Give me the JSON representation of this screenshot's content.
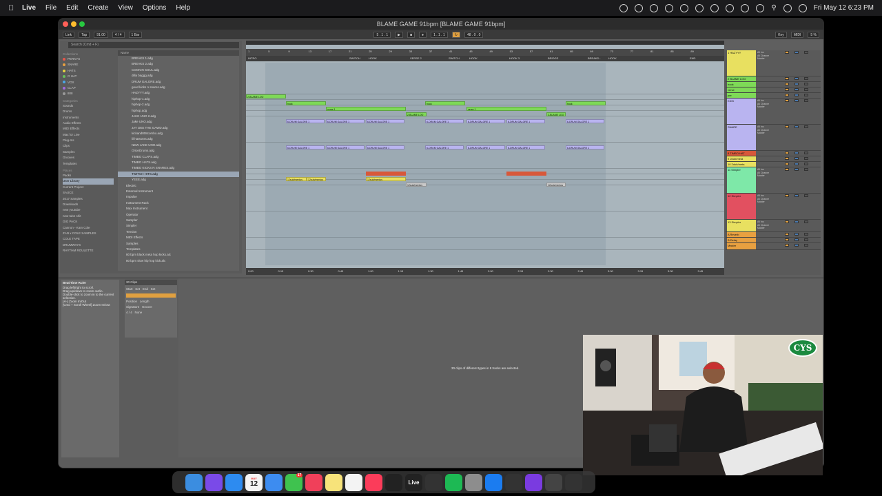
{
  "menubar": {
    "app_name": "Live",
    "items": [
      "File",
      "Edit",
      "Create",
      "View",
      "Options",
      "Help"
    ],
    "clock": "Fri May 12  6:23 PM"
  },
  "window": {
    "title": "BLAME GAME 91bpm  [BLAME GAME 91bpm]"
  },
  "transport": {
    "link": "Link",
    "tap": "Tap",
    "tempo": "91.00",
    "signature": "4 / 4",
    "quantize": "1 Bar",
    "position": "5 . 1 . 1",
    "loop_start": "1 . 1 . 1",
    "loop_length": "48 . 0 . 0",
    "key": "Key",
    "midi": "MIDI",
    "cpu": "5 %"
  },
  "browser": {
    "search_placeholder": "Search (Cmd + F)",
    "collections_title": "Collections",
    "collections": [
      {
        "label": "PERKYS",
        "color": "#e8564a"
      },
      {
        "label": "SNARE",
        "color": "#e8a040"
      },
      {
        "label": "HATS",
        "color": "#e8d240"
      },
      {
        "label": "O HAT",
        "color": "#68c05a"
      },
      {
        "label": "VOX",
        "color": "#4aa8e8"
      },
      {
        "label": "CLAP",
        "color": "#a36ae0"
      },
      {
        "label": "808",
        "color": "#9a9a9a"
      }
    ],
    "categories_title": "Categories",
    "categories": [
      "Sounds",
      "Drums",
      "Instruments",
      "Audio Effects",
      "MIDI Effects",
      "Max for Live",
      "Plug-Ins",
      "Clips",
      "Samples",
      "Grooves",
      "Templates"
    ],
    "places_title": "Places",
    "places": [
      "Packs",
      "User Library",
      "Current Project",
      "SAUCE",
      "2017 Samples",
      "Downloads",
      "new youtube",
      "new tube shit",
      "GIG PACK",
      "Cannon - Kam Cole",
      "ZAN x COLE SAMPLES",
      "COLE TAPE",
      "DRUMWAYS",
      "RHYTHM ROULETTE"
    ],
    "name_header": "Name",
    "files": [
      "BREAKS 1.adg",
      "BREAKS 2.adg",
      "COOKIN SOUL.adg",
      "dilla baggg.adg",
      "DRUM GALORE.adg",
      "good kicks n snares.adg",
      "HAZYYY.adg",
      "hiphop-1.adg",
      "hiphop-2.adg",
      "hiphop.adg",
      "JAKE UNO 2.adg",
      "Jake UNO.adg",
      "JAY DEE THE GAWD.adg",
      "kickand808combo.adg",
      "lil hatsssss.adg",
      "NEW JAKE UNO.adg",
      "OrionDrums.adg",
      "TIMBO CLAPS.adg",
      "TIMBO HATS.adg",
      "TIMBO KICKS N SNARES.adg",
      "TWITCH HITS.adg",
      "YEEE.adg"
    ],
    "folders": [
      "Electric",
      "External Instrument",
      "Impulse",
      "Instrument Rack",
      "Max Instrument",
      "Operator",
      "Sampler",
      "Simpler",
      "Tension",
      "MIDI Effects",
      "Samples",
      "Templates"
    ],
    "extra_files": [
      "80 bpm black meta hop kicks.alc",
      "80 bpm slow hip hop kick.alc"
    ]
  },
  "arrangement": {
    "bar_numbers": [
      "1",
      "5",
      "9",
      "13",
      "17",
      "21",
      "25",
      "29",
      "33",
      "37",
      "41",
      "45",
      "49",
      "53",
      "57",
      "61",
      "65",
      "69",
      "73",
      "77",
      "81",
      "85",
      "89"
    ],
    "locators": [
      "INTRO",
      "SWITCH",
      "HOOK",
      "VERSE 2",
      "SWITCH",
      "HOOK",
      "HOOK 3",
      "BRIDGE",
      "BREAKD..",
      "HOOK",
      "END"
    ],
    "times": [
      "0:00",
      "0:15",
      "0:30",
      "0:45",
      "1:00",
      "1:15",
      "1:30",
      "1:45",
      "2:00",
      "2:15",
      "2:30",
      "2:45",
      "3:00",
      "3:15",
      "3:30",
      "3:45"
    ],
    "clip_labels": {
      "blame": "2-BLAME LOO",
      "hook": "hook",
      "verse": "verse 1",
      "drum": "6-DRUM GALORE 1",
      "sub": "12sub/mentos"
    }
  },
  "mixer": {
    "tracks": [
      {
        "name": "1 HAZYYY",
        "color": "#e8e060"
      },
      {
        "name": "2 BLAME LOO",
        "color": "#7ed957"
      },
      {
        "name": "hook",
        "color": "#7ed957"
      },
      {
        "name": "verse",
        "color": "#7ed957"
      },
      {
        "name": "pre",
        "color": "#7ed957"
      },
      {
        "name": "KICK",
        "color": "#b9b4f0"
      },
      {
        "name": "SNARE",
        "color": "#b9b4f0"
      },
      {
        "name": "8 TIMBO HAT",
        "color": "#d8583a"
      },
      {
        "name": "9 2dub/meta",
        "color": "#e8e060"
      },
      {
        "name": "10 2dub/meta",
        "color": "#e8e060"
      },
      {
        "name": "11 Simpler",
        "color": "#7ee8a8"
      },
      {
        "name": "12 Simpler",
        "color": "#e25060"
      },
      {
        "name": "13 Simpler",
        "color": "#e8e060"
      },
      {
        "name": "A Reverb",
        "color": "#e8a040"
      },
      {
        "name": "B Delay",
        "color": "#e8a040"
      },
      {
        "name": "Master",
        "color": "#e8a040"
      }
    ],
    "io_in": "All Ins",
    "io_channel": "All Channe",
    "monitor": [
      "In",
      "Auto",
      "Off"
    ],
    "master_label": "Master",
    "master_ratio": "1/2"
  },
  "detail": {
    "info_title": "Beat/Time Ruler",
    "info_lines": [
      "Drag left/right to scroll.",
      "Drag up/down to zoom out/in.",
      "Double-click to zoom in to the current selection.",
      "",
      "[+/-] Zoom In/Out",
      "[Cmd + Scroll Wheel] Zoom In/Out"
    ],
    "clip_header": "30 Clips",
    "start_label": "Start",
    "end_label": "End",
    "set_label": "Set",
    "position_label": "Position",
    "length_label": "Length",
    "signature_label": "Signature",
    "groove_label": "Groove",
    "signature_value": "4 / 4",
    "groove_value": "None",
    "message": "30 clips of different types in 9 tracks are selected."
  },
  "webcam": {
    "logo_text": "CYS"
  },
  "dock": {
    "calendar_month": "MAY",
    "calendar_day": "12",
    "live_label": "Live",
    "notes_badge": "17",
    "icons": [
      "finder-icon",
      "siri-icon",
      "safari-icon",
      "calendar-icon",
      "mail-icon",
      "messages-icon",
      "news-icon",
      "notes-icon",
      "freeform-icon",
      "music-icon",
      "notion-icon",
      "live-icon",
      "maschine-icon",
      "spotify-icon",
      "settings-icon",
      "appstore-icon",
      "antares-icon",
      "waves-icon",
      "midi-icon",
      "keys-icon"
    ]
  }
}
